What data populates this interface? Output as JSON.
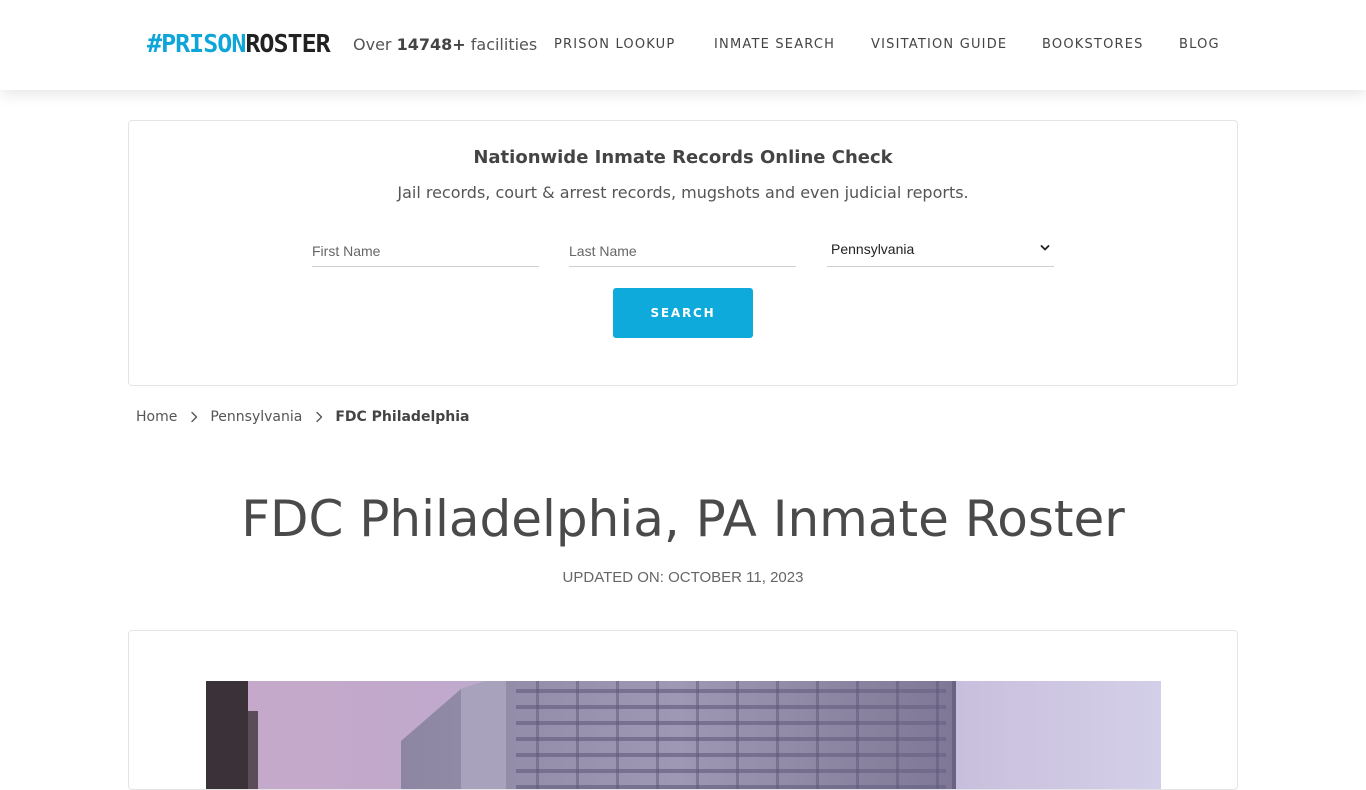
{
  "header": {
    "logo": {
      "hash": "#",
      "prison": "PRISON",
      "roster": "ROSTER"
    },
    "facilities": {
      "prefix": "Over",
      "count": "14748+",
      "suffix": "facilities"
    },
    "nav": [
      {
        "label": "PRISON LOOKUP"
      },
      {
        "label": "INMATE SEARCH"
      },
      {
        "label": "VISITATION GUIDE"
      },
      {
        "label": "BOOKSTORES"
      },
      {
        "label": "BLOG"
      }
    ]
  },
  "search": {
    "title": "Nationwide Inmate Records Online Check",
    "subtitle": "Jail records, court & arrest records, mugshots and even judicial reports.",
    "first_name_placeholder": "First Name",
    "last_name_placeholder": "Last Name",
    "state_selected": "Pennsylvania",
    "button_label": "SEARCH"
  },
  "breadcrumb": {
    "home": "Home",
    "state": "Pennsylvania",
    "current": "FDC Philadelphia"
  },
  "page": {
    "title": "FDC Philadelphia, PA Inmate Roster",
    "updated": "UPDATED ON: OCTOBER 11, 2023"
  },
  "colors": {
    "accent": "#0eaadc",
    "text": "#4a4a4a"
  },
  "icons": {
    "breadcrumb_separator": "chevron-right-icon",
    "select_arrow": "chevron-down-icon"
  }
}
